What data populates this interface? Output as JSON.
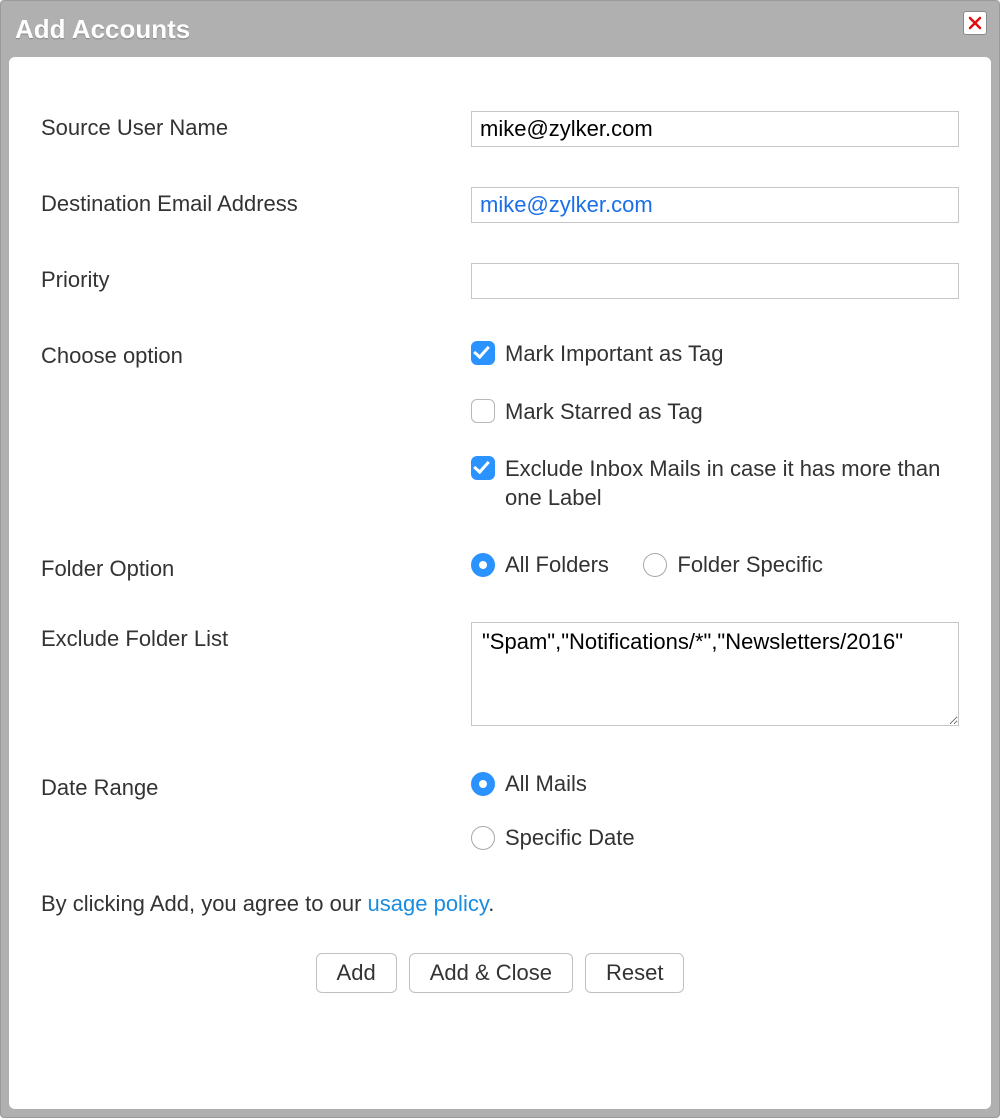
{
  "dialog": {
    "title": "Add Accounts"
  },
  "labels": {
    "source_user_name": "Source User Name",
    "destination_email": "Destination Email Address",
    "priority": "Priority",
    "choose_option": "Choose option",
    "folder_option": "Folder Option",
    "exclude_folder_list": "Exclude Folder List",
    "date_range": "Date Range"
  },
  "fields": {
    "source_user_name": "mike@zylker.com",
    "destination_email": "mike@zylker.com",
    "priority": "",
    "exclude_folder_list": "\"Spam\",\"Notifications/*\",\"Newsletters/2016\""
  },
  "choose_options": [
    {
      "label": "Mark Important as Tag",
      "checked": true
    },
    {
      "label": "Mark Starred as Tag",
      "checked": false
    },
    {
      "label": "Exclude Inbox Mails in case it has more than one Label",
      "checked": true
    }
  ],
  "folder_options": [
    {
      "label": "All Folders",
      "selected": true
    },
    {
      "label": "Folder Specific",
      "selected": false
    }
  ],
  "date_range_options": [
    {
      "label": "All Mails",
      "selected": true
    },
    {
      "label": "Specific Date",
      "selected": false
    }
  ],
  "agree": {
    "prefix": "By clicking Add, you agree to our ",
    "link": "usage policy",
    "suffix": "."
  },
  "buttons": {
    "add": "Add",
    "add_close": "Add & Close",
    "reset": "Reset"
  }
}
